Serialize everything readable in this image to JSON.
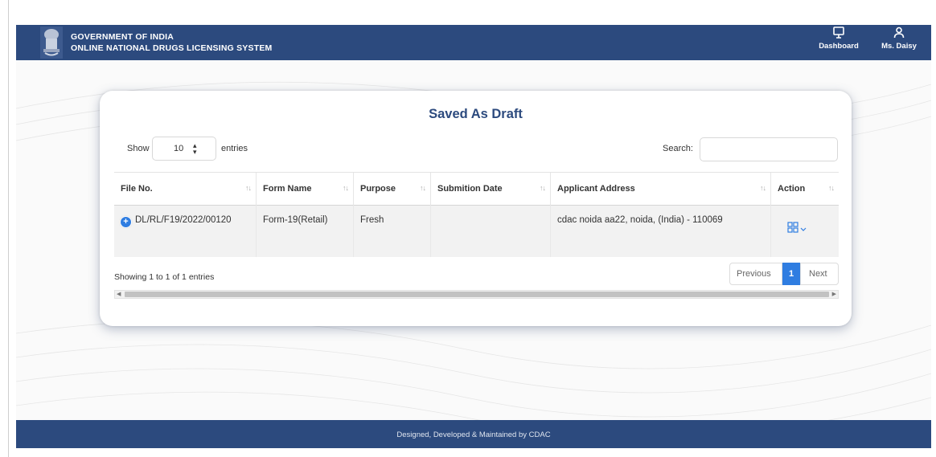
{
  "header": {
    "title_line1": "GOVERNMENT OF INDIA",
    "title_line2": "ONLINE NATIONAL DRUGS LICENSING SYSTEM",
    "dashboard_label": "Dashboard",
    "user_label": "Ms. Daisy",
    "background_color": "#2c4a7e"
  },
  "card": {
    "title": "Saved As Draft",
    "show_label": "Show",
    "entries_value": "10",
    "entries_label": "entries",
    "search_label": "Search:",
    "search_value": ""
  },
  "table": {
    "columns": [
      "File No.",
      "Form Name",
      "Purpose",
      "Submition Date",
      "Applicant Address",
      "Action"
    ],
    "rows": [
      {
        "file_no": "DL/RL/F19/2022/00120",
        "form_name": "Form-19(Retail)",
        "purpose": "Fresh",
        "submission_date": "",
        "applicant_address": "cdac noida aa22, noida, (India) - 110069"
      }
    ]
  },
  "pagination": {
    "info": "Showing 1 to 1 of 1 entries",
    "previous": "Previous",
    "current_page": "1",
    "next": "Next"
  },
  "footer": {
    "text": "Designed, Developed & Maintained by CDAC"
  },
  "icons": [
    "emblem-icon",
    "monitor-icon",
    "user-icon",
    "sort-icon",
    "expand-plus-icon",
    "grid-icon",
    "chevron-down-icon"
  ],
  "colors": {
    "primary": "#2c4a7e",
    "accent": "#2f7de1"
  }
}
